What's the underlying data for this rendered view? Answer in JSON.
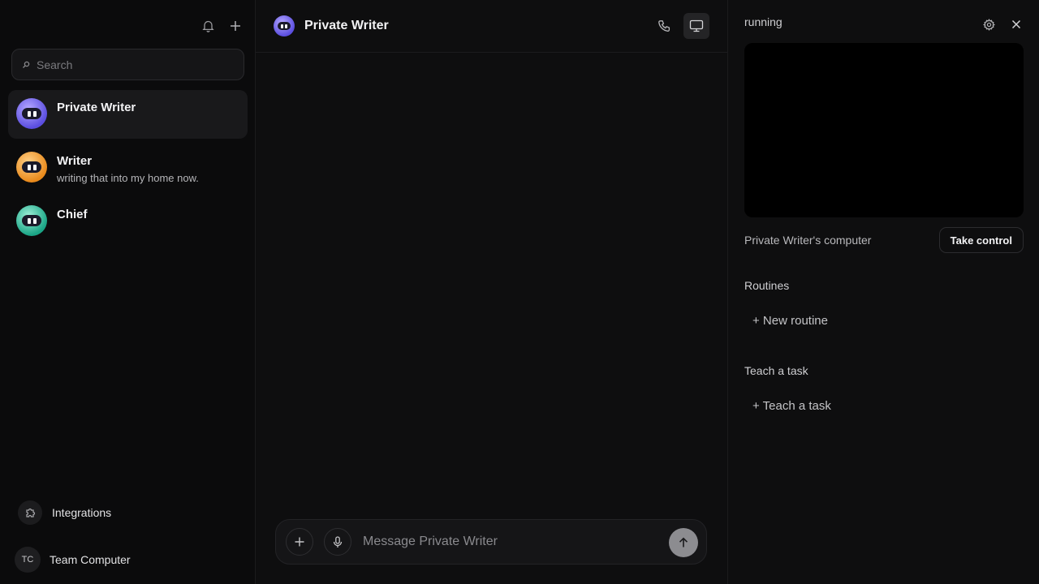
{
  "sidebar": {
    "search_placeholder": "Search",
    "chats": [
      {
        "name": "Private Writer",
        "preview": "",
        "avatar": "purple"
      },
      {
        "name": "Writer",
        "preview": "writing that into my home now.",
        "avatar": "orange"
      },
      {
        "name": "Chief",
        "preview": "",
        "avatar": "teal"
      }
    ],
    "integrations_label": "Integrations",
    "team_initials": "TC",
    "team_label": "Team Computer"
  },
  "main": {
    "title": "Private Writer",
    "composer_placeholder": "Message Private Writer"
  },
  "panel": {
    "status": "running",
    "computer_label": "Private Writer's computer",
    "take_control_label": "Take control",
    "routines_title": "Routines",
    "new_routine_label": "+ New routine",
    "teach_title": "Teach a task",
    "teach_link_label": "+ Teach a task"
  },
  "colors": {
    "background": "#0e0e0f",
    "sidebar_bg": "#0b0b0c",
    "active_item": "#19191b",
    "send_button": "#8c8c90"
  }
}
